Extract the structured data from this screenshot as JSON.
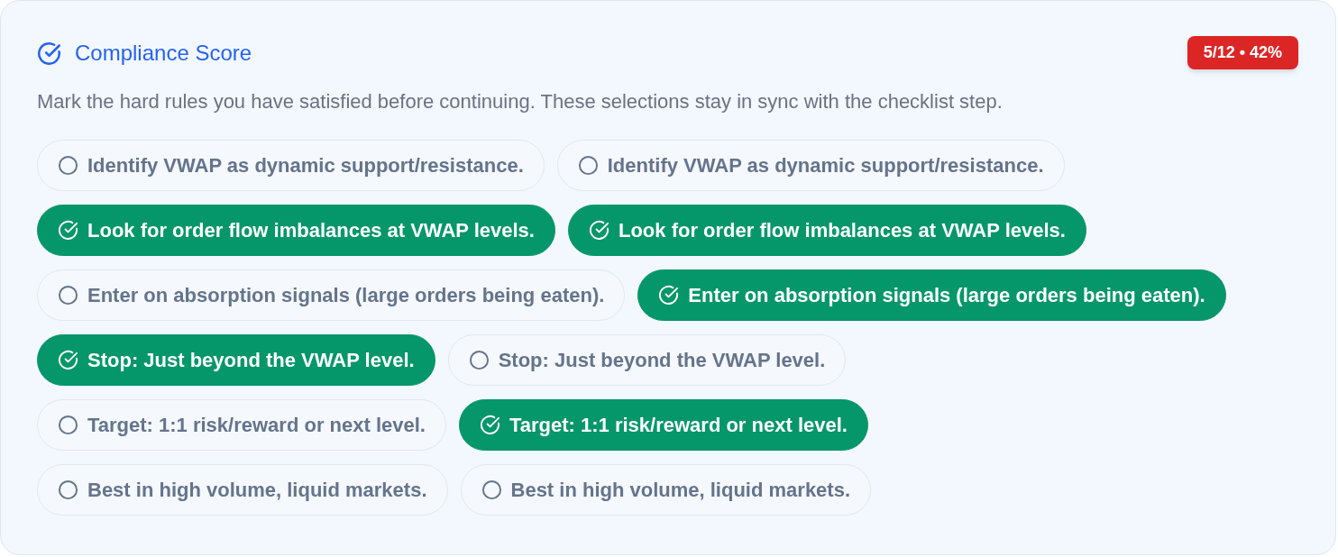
{
  "header": {
    "title": "Compliance Score",
    "badge": "5/12 • 42%"
  },
  "description": "Mark the hard rules you have satisfied before continuing. These selections stay in sync with the checklist step.",
  "rules": [
    {
      "label": "Identify VWAP as dynamic support/resistance.",
      "checked": false
    },
    {
      "label": "Identify VWAP as dynamic support/resistance.",
      "checked": false
    },
    {
      "label": "Look for order flow imbalances at VWAP levels.",
      "checked": true
    },
    {
      "label": "Look for order flow imbalances at VWAP levels.",
      "checked": true
    },
    {
      "label": "Enter on absorption signals (large orders being eaten).",
      "checked": false
    },
    {
      "label": "Enter on absorption signals (large orders being eaten).",
      "checked": true
    },
    {
      "label": "Stop: Just beyond the VWAP level.",
      "checked": true
    },
    {
      "label": "Stop: Just beyond the VWAP level.",
      "checked": false
    },
    {
      "label": "Target: 1:1 risk/reward or next level.",
      "checked": false
    },
    {
      "label": "Target: 1:1 risk/reward or next level.",
      "checked": true
    },
    {
      "label": "Best in high volume, liquid markets.",
      "checked": false
    },
    {
      "label": "Best in high volume, liquid markets.",
      "checked": false
    }
  ]
}
